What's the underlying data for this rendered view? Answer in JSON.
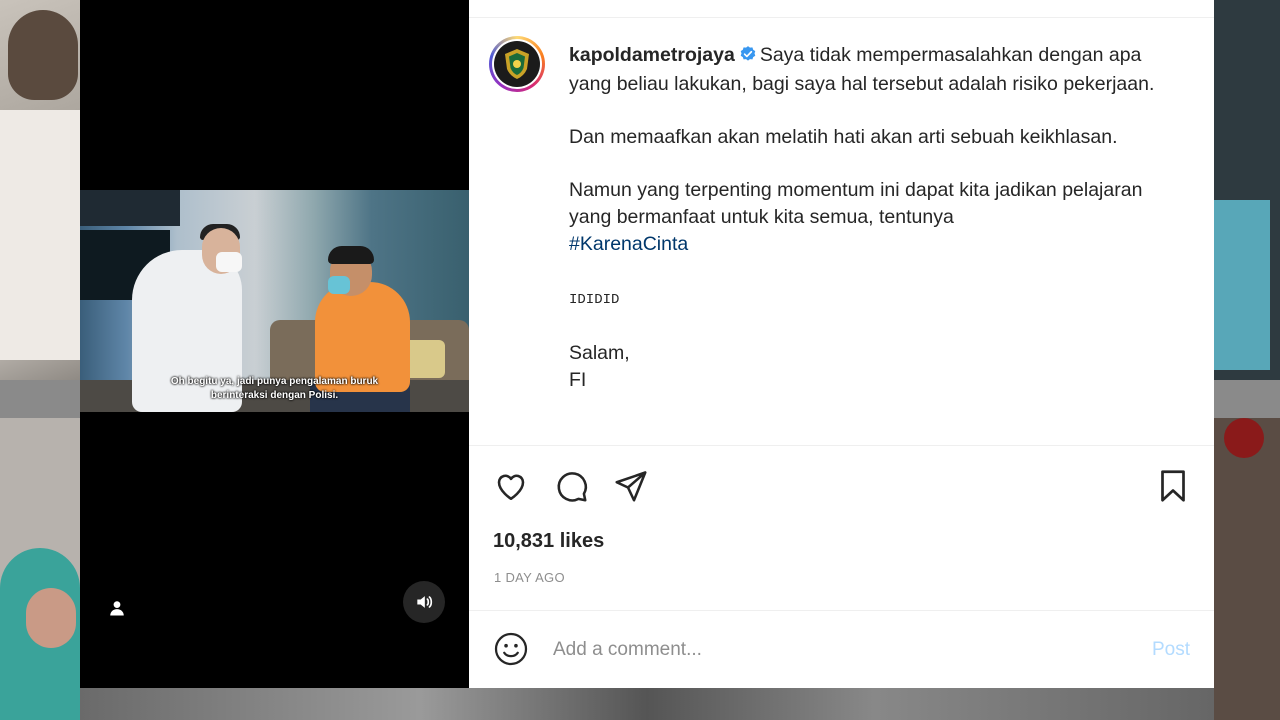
{
  "post": {
    "username": "kapoldametrojaya",
    "caption_paragraphs": [
      "Saya tidak mempermasalahkan dengan apa yang beliau lakukan, bagi saya hal tersebut adalah risiko pekerjaan.",
      "Dan memaafkan akan melatih hati akan arti sebuah keikhlasan.",
      "Namun yang terpenting momentum ini dapat kita jadikan pelajaran yang bermanfaat untuk kita semua, tentunya"
    ],
    "hashtag": "#KarenaCinta",
    "mono_line": "IDIDID",
    "sign_off_1": "Salam,",
    "sign_off_2": "FI",
    "likes": "10,831 likes",
    "time_ago": "1 DAY AGO"
  },
  "video": {
    "subtitle_line_1": "Oh begitu ya, jadi punya pengalaman buruk",
    "subtitle_line_2": "berinteraksi dengan Polisi."
  },
  "comment": {
    "placeholder": "Add a comment...",
    "post_label": "Post"
  },
  "icons": {
    "verified": "verified-badge-icon",
    "like": "heart-icon",
    "comment": "comment-bubble-icon",
    "share": "paper-plane-icon",
    "save": "bookmark-icon",
    "emoji": "smiley-icon",
    "sound": "speaker-icon",
    "tag": "user-icon"
  },
  "colors": {
    "hashtag": "#00376b",
    "verified": "#3897f0",
    "post_disabled": "#b3dbff"
  }
}
